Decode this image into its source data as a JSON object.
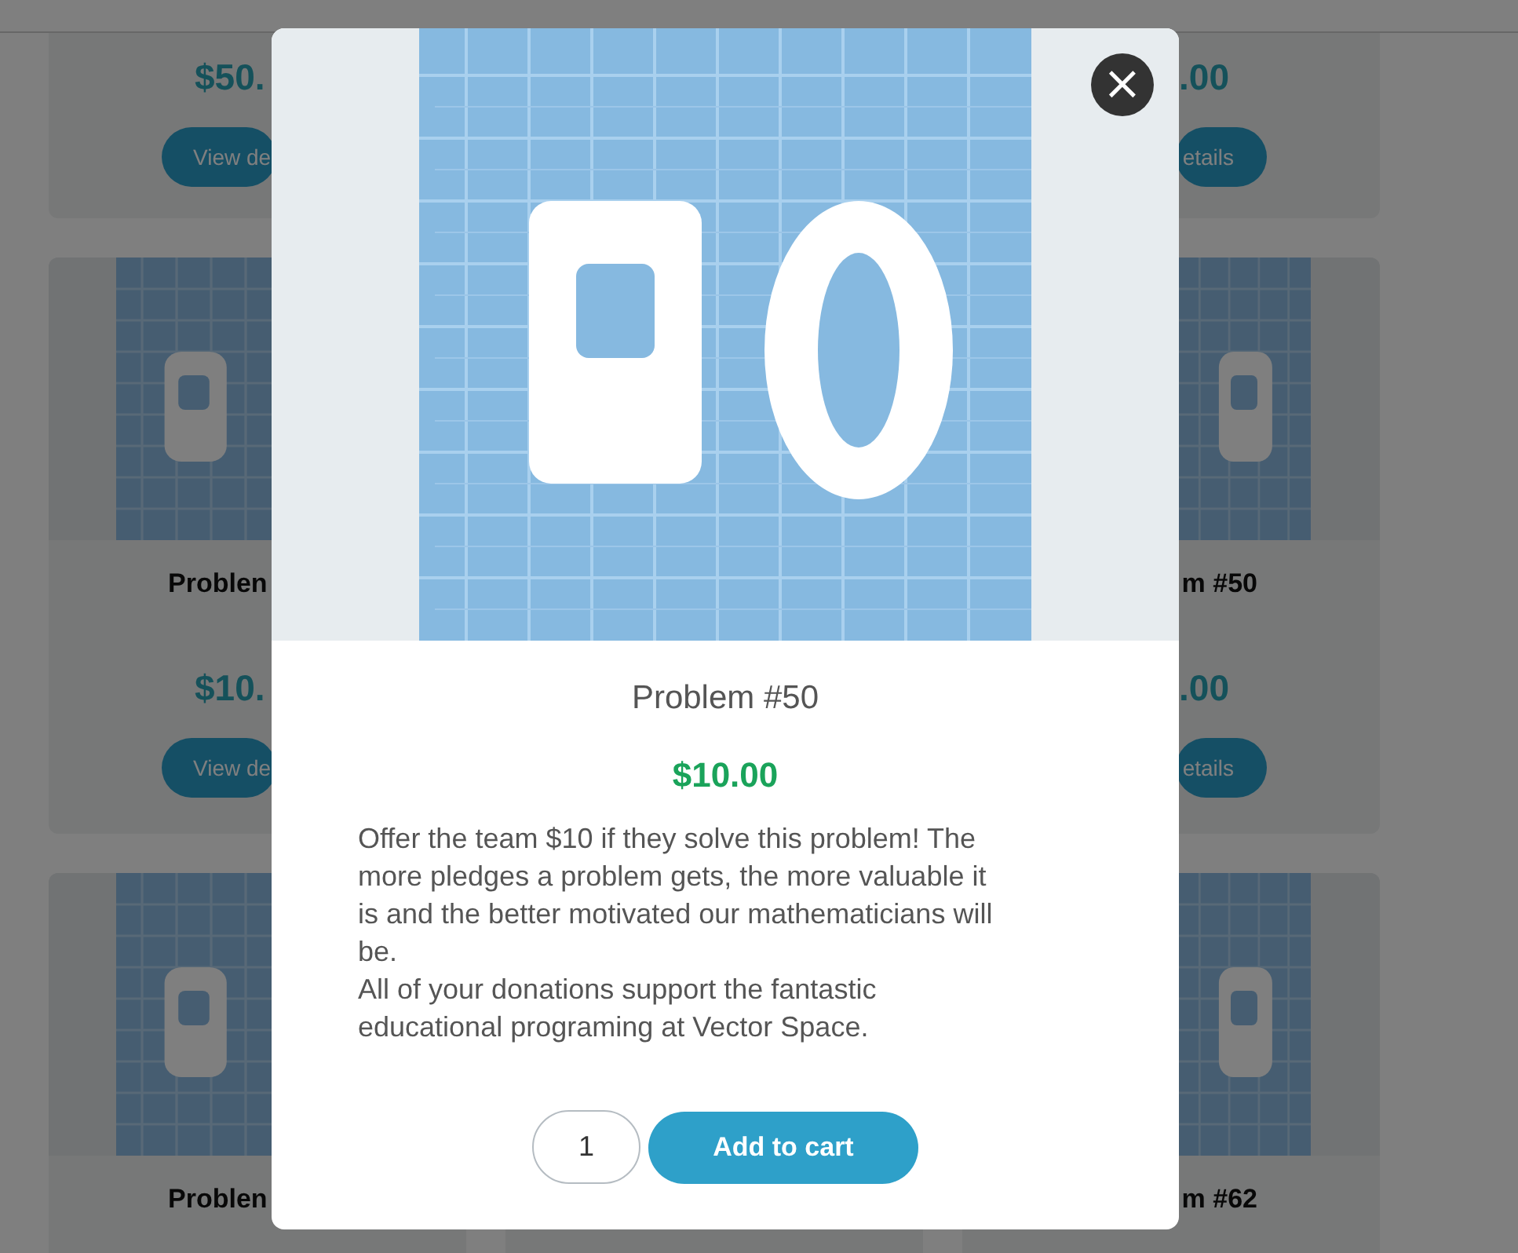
{
  "rows": [
    {
      "left": {
        "price": "$50.",
        "button": "View de"
      },
      "right": {
        "price": ".00",
        "button": "etails"
      }
    },
    {
      "image": {
        "kind": "picture"
      },
      "left": {
        "title": "Problen",
        "price": "$10.",
        "button": "View de"
      },
      "right": {
        "title": "m #50",
        "price": ".00",
        "button": "etails"
      }
    },
    {
      "image": {
        "kind": "picture"
      },
      "left": {
        "title": "Problen"
      },
      "right": {
        "title": "m #62"
      }
    }
  ],
  "modal": {
    "image": {
      "kind": "picture"
    },
    "close": "×",
    "title": "Problem #50",
    "price": "$10.00",
    "description": [
      "Offer the team $10 if they solve this problem! The more pledges a problem gets, the more valuable it is and the better motivated our mathematicians will be.",
      "All of your donations support the fantastic educational programing at Vector Space."
    ],
    "quantity": "1",
    "button": "Add to cart"
  }
}
